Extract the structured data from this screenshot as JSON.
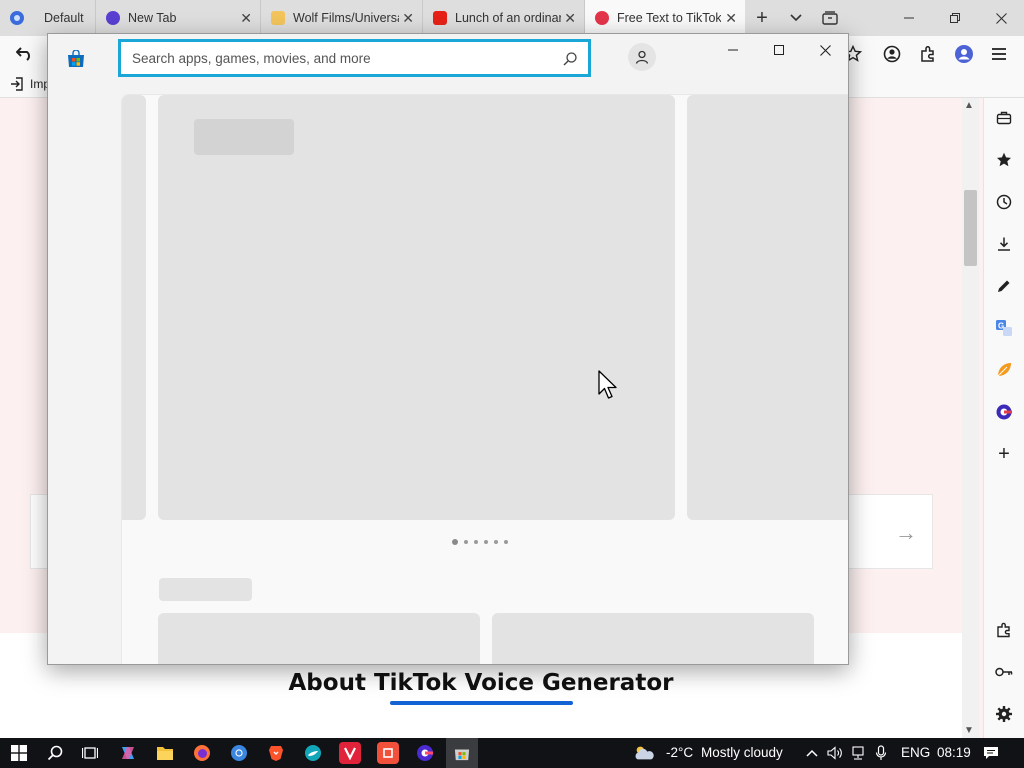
{
  "browser": {
    "tabs": [
      {
        "label": "Default",
        "favicon": "edge-workspaces-icon"
      },
      {
        "label": "New Tab",
        "favicon": "firefox-style-icon"
      },
      {
        "label": "Wolf Films/Universa",
        "favicon": "fandom-icon"
      },
      {
        "label": "Lunch of an ordinar",
        "favicon": "youtube-icon"
      },
      {
        "label": "Free Text to TikTok V",
        "favicon": "tiktok-tts-icon"
      }
    ],
    "bookmarks_item": "Imp",
    "accent_color": "#1aa7d8"
  },
  "store": {
    "search_placeholder": "Search apps, games, movies, and more",
    "search_value": "",
    "carousel_dots": 6,
    "carousel_active": 0
  },
  "page": {
    "about_title": "About TikTok Voice Generator",
    "arrow": "→"
  },
  "taskbar": {
    "weather_temp": "-2°C",
    "weather_text": "Mostly cloudy",
    "language": "ENG",
    "time": "08:19"
  },
  "icons": {
    "sidepanel": [
      "briefcase-icon",
      "star-icon",
      "history-icon",
      "download-icon",
      "pen-icon",
      "translate-icon",
      "leaf-icon",
      "extension-app-icon",
      "plus-icon",
      "puzzle-icon",
      "key-icon",
      "gear-icon"
    ]
  }
}
